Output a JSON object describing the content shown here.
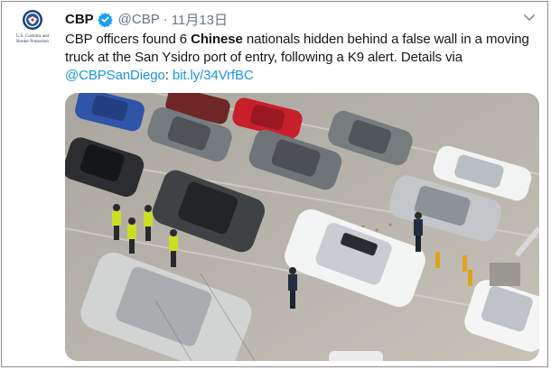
{
  "account": {
    "display_name": "CBP",
    "handle": "@CBP",
    "separator": "·",
    "date": "11月13日",
    "avatar_org_line1": "U.S. Customs and",
    "avatar_org_line2": "Border Protection"
  },
  "tweet": {
    "text_part1": "CBP officers found 6 ",
    "text_bold": "Chinese",
    "text_part2": " nationals hidden behind a false wall in a moving truck at the San Ysidro port of entry, following a K9 alert. Details via ",
    "mention": "@CBPSanDiego",
    "text_part3": ": ",
    "link": "bit.ly/34VrfBC"
  },
  "colors": {
    "link": "#1b95e0",
    "verified": "#1da1f2",
    "secondary_text": "#657786",
    "pavement": "#b5b2aa"
  },
  "icons": {
    "verified": "verified-badge-icon",
    "menu": "chevron-down-icon"
  }
}
